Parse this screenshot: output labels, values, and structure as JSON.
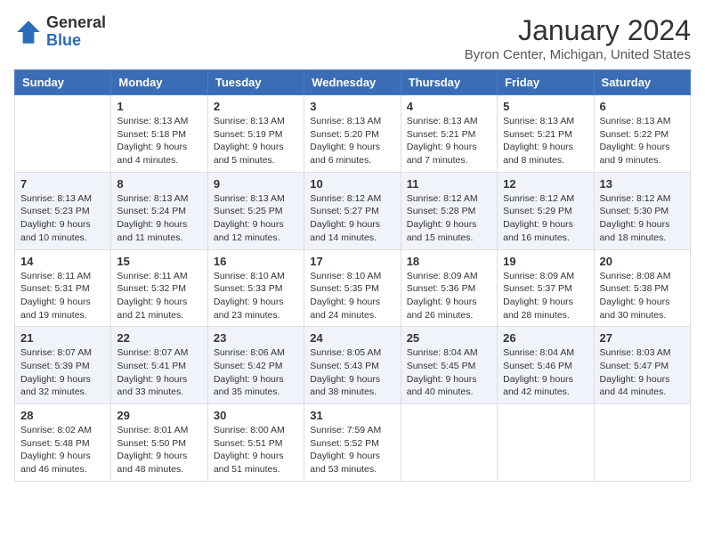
{
  "header": {
    "logo_general": "General",
    "logo_blue": "Blue",
    "month_title": "January 2024",
    "location": "Byron Center, Michigan, United States"
  },
  "days_of_week": [
    "Sunday",
    "Monday",
    "Tuesday",
    "Wednesday",
    "Thursday",
    "Friday",
    "Saturday"
  ],
  "weeks": [
    [
      {
        "day": "",
        "info": ""
      },
      {
        "day": "1",
        "info": "Sunrise: 8:13 AM\nSunset: 5:18 PM\nDaylight: 9 hours\nand 4 minutes."
      },
      {
        "day": "2",
        "info": "Sunrise: 8:13 AM\nSunset: 5:19 PM\nDaylight: 9 hours\nand 5 minutes."
      },
      {
        "day": "3",
        "info": "Sunrise: 8:13 AM\nSunset: 5:20 PM\nDaylight: 9 hours\nand 6 minutes."
      },
      {
        "day": "4",
        "info": "Sunrise: 8:13 AM\nSunset: 5:21 PM\nDaylight: 9 hours\nand 7 minutes."
      },
      {
        "day": "5",
        "info": "Sunrise: 8:13 AM\nSunset: 5:21 PM\nDaylight: 9 hours\nand 8 minutes."
      },
      {
        "day": "6",
        "info": "Sunrise: 8:13 AM\nSunset: 5:22 PM\nDaylight: 9 hours\nand 9 minutes."
      }
    ],
    [
      {
        "day": "7",
        "info": "Sunrise: 8:13 AM\nSunset: 5:23 PM\nDaylight: 9 hours\nand 10 minutes."
      },
      {
        "day": "8",
        "info": "Sunrise: 8:13 AM\nSunset: 5:24 PM\nDaylight: 9 hours\nand 11 minutes."
      },
      {
        "day": "9",
        "info": "Sunrise: 8:13 AM\nSunset: 5:25 PM\nDaylight: 9 hours\nand 12 minutes."
      },
      {
        "day": "10",
        "info": "Sunrise: 8:12 AM\nSunset: 5:27 PM\nDaylight: 9 hours\nand 14 minutes."
      },
      {
        "day": "11",
        "info": "Sunrise: 8:12 AM\nSunset: 5:28 PM\nDaylight: 9 hours\nand 15 minutes."
      },
      {
        "day": "12",
        "info": "Sunrise: 8:12 AM\nSunset: 5:29 PM\nDaylight: 9 hours\nand 16 minutes."
      },
      {
        "day": "13",
        "info": "Sunrise: 8:12 AM\nSunset: 5:30 PM\nDaylight: 9 hours\nand 18 minutes."
      }
    ],
    [
      {
        "day": "14",
        "info": "Sunrise: 8:11 AM\nSunset: 5:31 PM\nDaylight: 9 hours\nand 19 minutes."
      },
      {
        "day": "15",
        "info": "Sunrise: 8:11 AM\nSunset: 5:32 PM\nDaylight: 9 hours\nand 21 minutes."
      },
      {
        "day": "16",
        "info": "Sunrise: 8:10 AM\nSunset: 5:33 PM\nDaylight: 9 hours\nand 23 minutes."
      },
      {
        "day": "17",
        "info": "Sunrise: 8:10 AM\nSunset: 5:35 PM\nDaylight: 9 hours\nand 24 minutes."
      },
      {
        "day": "18",
        "info": "Sunrise: 8:09 AM\nSunset: 5:36 PM\nDaylight: 9 hours\nand 26 minutes."
      },
      {
        "day": "19",
        "info": "Sunrise: 8:09 AM\nSunset: 5:37 PM\nDaylight: 9 hours\nand 28 minutes."
      },
      {
        "day": "20",
        "info": "Sunrise: 8:08 AM\nSunset: 5:38 PM\nDaylight: 9 hours\nand 30 minutes."
      }
    ],
    [
      {
        "day": "21",
        "info": "Sunrise: 8:07 AM\nSunset: 5:39 PM\nDaylight: 9 hours\nand 32 minutes."
      },
      {
        "day": "22",
        "info": "Sunrise: 8:07 AM\nSunset: 5:41 PM\nDaylight: 9 hours\nand 33 minutes."
      },
      {
        "day": "23",
        "info": "Sunrise: 8:06 AM\nSunset: 5:42 PM\nDaylight: 9 hours\nand 35 minutes."
      },
      {
        "day": "24",
        "info": "Sunrise: 8:05 AM\nSunset: 5:43 PM\nDaylight: 9 hours\nand 38 minutes."
      },
      {
        "day": "25",
        "info": "Sunrise: 8:04 AM\nSunset: 5:45 PM\nDaylight: 9 hours\nand 40 minutes."
      },
      {
        "day": "26",
        "info": "Sunrise: 8:04 AM\nSunset: 5:46 PM\nDaylight: 9 hours\nand 42 minutes."
      },
      {
        "day": "27",
        "info": "Sunrise: 8:03 AM\nSunset: 5:47 PM\nDaylight: 9 hours\nand 44 minutes."
      }
    ],
    [
      {
        "day": "28",
        "info": "Sunrise: 8:02 AM\nSunset: 5:48 PM\nDaylight: 9 hours\nand 46 minutes."
      },
      {
        "day": "29",
        "info": "Sunrise: 8:01 AM\nSunset: 5:50 PM\nDaylight: 9 hours\nand 48 minutes."
      },
      {
        "day": "30",
        "info": "Sunrise: 8:00 AM\nSunset: 5:51 PM\nDaylight: 9 hours\nand 51 minutes."
      },
      {
        "day": "31",
        "info": "Sunrise: 7:59 AM\nSunset: 5:52 PM\nDaylight: 9 hours\nand 53 minutes."
      },
      {
        "day": "",
        "info": ""
      },
      {
        "day": "",
        "info": ""
      },
      {
        "day": "",
        "info": ""
      }
    ]
  ]
}
